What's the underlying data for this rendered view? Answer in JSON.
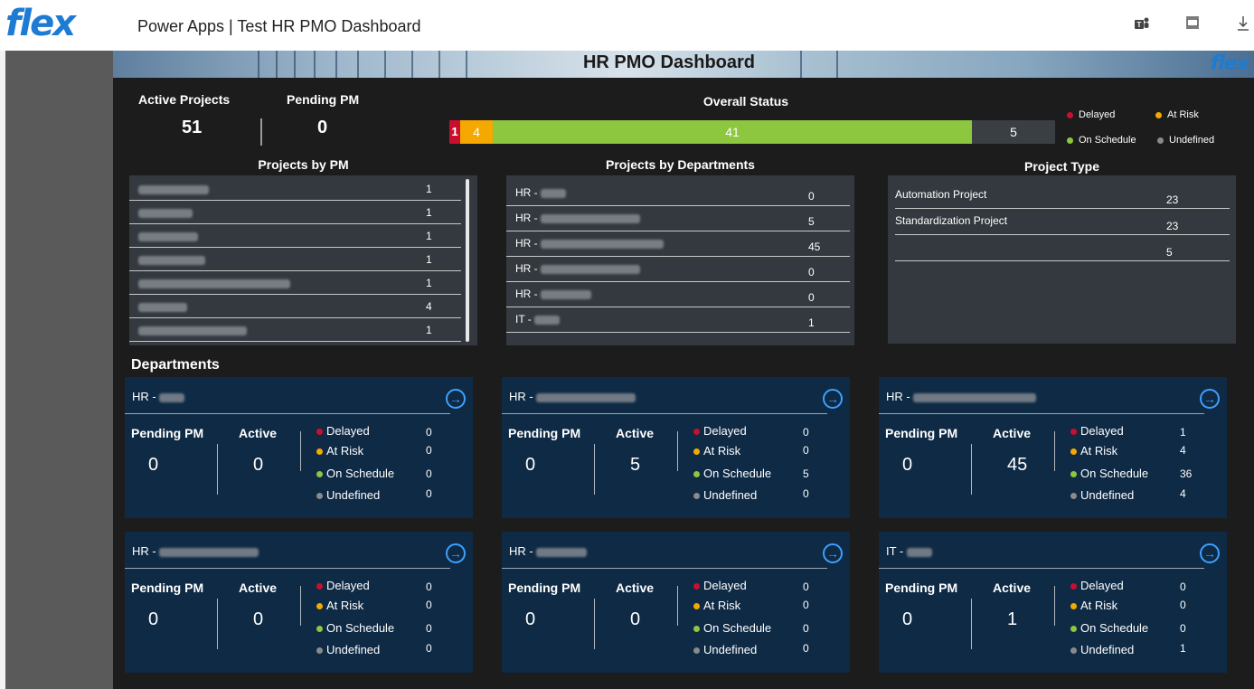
{
  "header": {
    "logo": "flex",
    "app_title": "Power Apps  |  Test HR PMO Dashboard",
    "icons": [
      "teams-icon",
      "fullscreen-icon",
      "download-icon"
    ]
  },
  "banner": {
    "title": "HR PMO Dashboard",
    "logo": "flex"
  },
  "kpi": {
    "active_label": "Active Projects",
    "active_value": "51",
    "pending_label": "Pending PM",
    "pending_value": "0"
  },
  "overall_status": {
    "title": "Overall Status",
    "segments": [
      {
        "label": "1",
        "value": 1,
        "color": "#c8102e"
      },
      {
        "label": "4",
        "value": 4,
        "color": "#f5a800"
      },
      {
        "label": "41",
        "value": 41,
        "color": "#8dc63f"
      },
      {
        "label": "5",
        "value": 5,
        "color": "#3a3f44"
      }
    ],
    "legend": {
      "delayed": "Delayed",
      "at_risk": "At Risk",
      "on_schedule": "On Schedule",
      "undefined": "Undefined"
    }
  },
  "colors": {
    "delayed": "#c8102e",
    "at_risk": "#f5a800",
    "on_schedule": "#8dc63f",
    "undefined": "#8a8a8a"
  },
  "projects_by_pm": {
    "title": "Projects by PM",
    "rows": [
      {
        "count": "1"
      },
      {
        "count": "1"
      },
      {
        "count": "1"
      },
      {
        "count": "1"
      },
      {
        "count": "1"
      },
      {
        "count": "4"
      },
      {
        "count": "1"
      }
    ]
  },
  "projects_by_departments": {
    "title": "Projects by Departments",
    "rows": [
      {
        "prefix": "HR - ",
        "count": "0"
      },
      {
        "prefix": "HR - ",
        "count": "5"
      },
      {
        "prefix": "HR - ",
        "count": "45"
      },
      {
        "prefix": "HR - ",
        "count": "0"
      },
      {
        "prefix": "HR - ",
        "count": "0"
      },
      {
        "prefix": "IT - ",
        "count": "1"
      }
    ]
  },
  "project_type": {
    "title": "Project Type",
    "rows": [
      {
        "name": "Automation Project",
        "count": "23"
      },
      {
        "name": "Standardization Project",
        "count": "23"
      },
      {
        "name": "",
        "count": "5"
      }
    ]
  },
  "departments": {
    "title": "Departments",
    "labels": {
      "pending": "Pending PM",
      "active": "Active"
    },
    "cards": [
      {
        "prefix": "HR - ",
        "pending": "0",
        "active": "0",
        "delayed": "0",
        "at_risk": "0",
        "on_schedule": "0",
        "undefined": "0"
      },
      {
        "prefix": "HR - ",
        "pending": "0",
        "active": "5",
        "delayed": "0",
        "at_risk": "0",
        "on_schedule": "5",
        "undefined": "0"
      },
      {
        "prefix": "HR - ",
        "pending": "0",
        "active": "45",
        "delayed": "1",
        "at_risk": "4",
        "on_schedule": "36",
        "undefined": "4"
      },
      {
        "prefix": "HR - ",
        "pending": "0",
        "active": "0",
        "delayed": "0",
        "at_risk": "0",
        "on_schedule": "0",
        "undefined": "0"
      },
      {
        "prefix": "HR - ",
        "pending": "0",
        "active": "0",
        "delayed": "0",
        "at_risk": "0",
        "on_schedule": "0",
        "undefined": "0"
      },
      {
        "prefix": "IT - ",
        "pending": "0",
        "active": "1",
        "delayed": "0",
        "at_risk": "0",
        "on_schedule": "0",
        "undefined": "1"
      }
    ]
  }
}
